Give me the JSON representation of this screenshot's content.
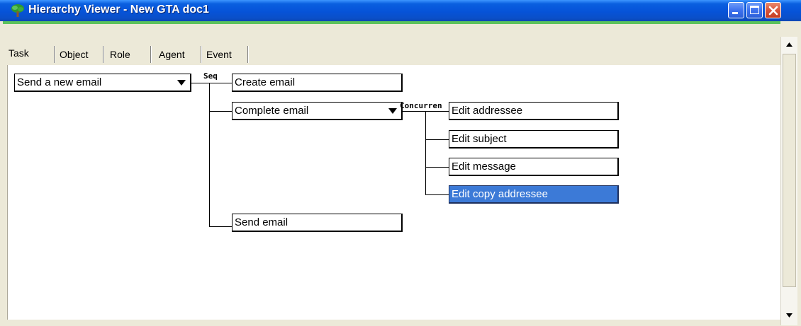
{
  "window": {
    "title": "Hierarchy Viewer - New GTA doc1",
    "title_icon": "tree-icon",
    "controls": [
      "minimize-icon",
      "maximize-icon",
      "close-icon"
    ],
    "colors": {
      "title_bar": "#0653d8",
      "accent_line": "#5cc35c",
      "selected_node": "#3c7ad7"
    }
  },
  "tabs": [
    {
      "label": "Task",
      "active": true
    },
    {
      "label": "Object",
      "active": false
    },
    {
      "label": "Role",
      "active": false
    },
    {
      "label": "Agent",
      "active": false
    },
    {
      "label": "Event",
      "active": false
    }
  ],
  "tree": {
    "root": {
      "label": "Send a new email",
      "has_dropdown": true
    },
    "root_operator": "Seq",
    "level1": [
      {
        "label": "Create email",
        "has_dropdown": false
      },
      {
        "label": "Complete email",
        "has_dropdown": true
      },
      {
        "label": "Send email",
        "has_dropdown": false
      }
    ],
    "level1_operator": "Concurren",
    "level2": [
      {
        "label": "Edit addressee",
        "selected": false
      },
      {
        "label": "Edit subject",
        "selected": false
      },
      {
        "label": "Edit message",
        "selected": false
      },
      {
        "label": "Edit copy addressee",
        "selected": true
      }
    ]
  },
  "scrollbar": {
    "up_icon": "scroll-up-arrow-icon",
    "down_icon": "scroll-down-arrow-icon"
  }
}
